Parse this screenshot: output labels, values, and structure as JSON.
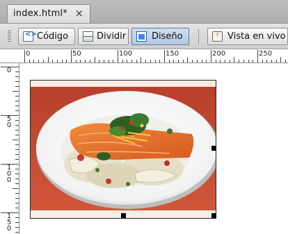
{
  "tabs": [
    {
      "label": "index.html*",
      "close": "×",
      "active": true
    }
  ],
  "view_buttons": [
    {
      "label": "Código",
      "icon": "code-view-icon",
      "active": false
    },
    {
      "label": "Dividir",
      "icon": "split-view-icon",
      "active": false
    },
    {
      "label": "Diseño",
      "icon": "design-view-icon",
      "active": true
    },
    {
      "label": "Vista en vivo",
      "icon": "live-view-icon",
      "active": false
    }
  ],
  "ruler": {
    "horizontal": [
      "0",
      "50",
      "100",
      "150",
      "200",
      "250"
    ],
    "vertical": [
      "0",
      "50",
      "100",
      "150"
    ]
  },
  "canvas": {
    "image_content": "salmon-fillet-plate-photo"
  },
  "colors": {
    "accent_active_button": "#b4c8e0",
    "selection_border": "#222222",
    "image_background": "#c0392b"
  }
}
